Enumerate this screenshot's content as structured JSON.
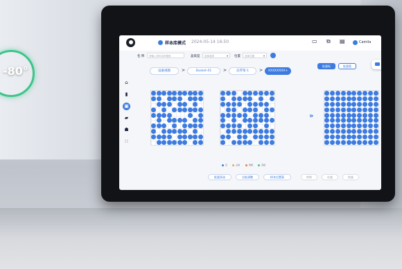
{
  "gauge": {
    "value_text": "-80°"
  },
  "topbar": {
    "mode_label": "样本库模式",
    "datetime": "2024-05-14 16:50",
    "icons": [
      "monitor-icon",
      "copy-icon",
      "clipboard-icon"
    ],
    "user": "Camila"
  },
  "filters": {
    "name_label": "名 称",
    "name_placeholder": "请输入样本名称搜索",
    "type_label": "盒类型",
    "type_placeholder": "选择盒类",
    "location_label": "位置",
    "location_placeholder": "选择位置"
  },
  "toolbar": {
    "primary_label": "批量标",
    "secondary_label": "批量管"
  },
  "breadcrumb": [
    {
      "label": "设备视图"
    },
    {
      "label": "Basket-01"
    },
    {
      "label": "冻存架-1"
    },
    {
      "label": "XXXXXXXX+"
    }
  ],
  "sidenav": [
    "home-icon",
    "document-icon",
    "box-icon",
    "folder-icon",
    "users-icon",
    "apps-icon"
  ],
  "grid": {
    "rows": 10,
    "cols": 10
  },
  "legend": [
    {
      "label": "空",
      "color": "#3d7be0"
    },
    {
      "label": "占用",
      "color": "#f0a83c"
    },
    {
      "label": "预留",
      "color": "#f07c3c"
    },
    {
      "label": "冻结",
      "color": "#43c28a"
    }
  ],
  "actions": {
    "btn1": "批量多选",
    "btn2": "分批调整",
    "btn3": "样本位置表",
    "btn4": "转移",
    "btn5": "存盒",
    "btn6": "取盒"
  }
}
